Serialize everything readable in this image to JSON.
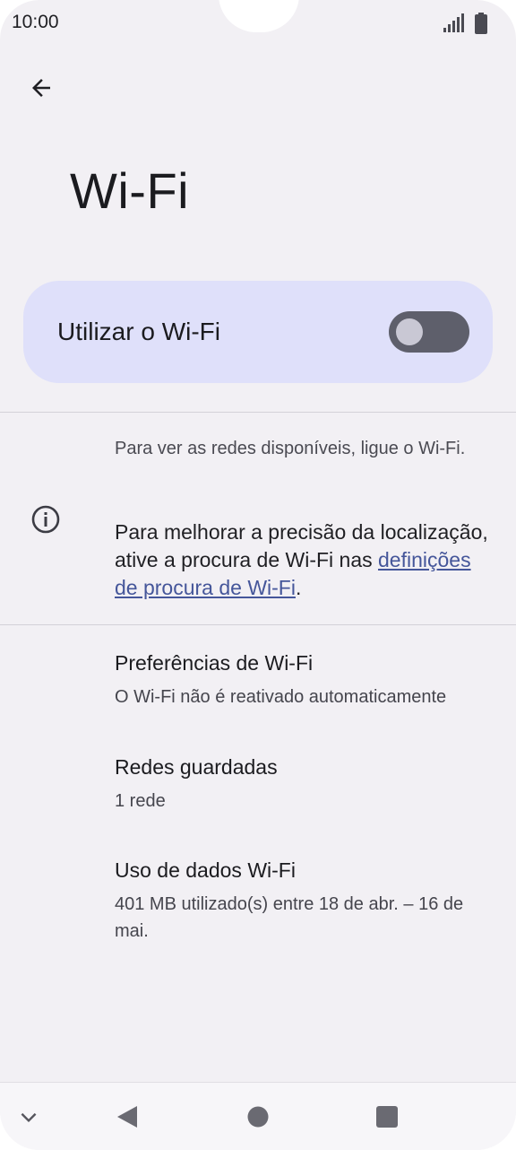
{
  "status_bar": {
    "time": "10:00",
    "icons": [
      "signal-icon",
      "battery-icon"
    ]
  },
  "app_bar": {
    "back_icon": "arrow-back-icon",
    "title": "Wi-Fi"
  },
  "main_switch": {
    "label": "Utilizar o Wi-Fi",
    "checked": false
  },
  "info": {
    "icon": "info-icon",
    "text_1": "Para ver as redes disponíveis, ligue o Wi-Fi.",
    "text_2_prefix": "Para melhorar a precisão da localização, ative a procura de Wi-Fi nas ",
    "text_2_link": "definições de procura de Wi-Fi",
    "text_2_suffix": "."
  },
  "items": [
    {
      "title": "Preferências de Wi-Fi",
      "summary": "O Wi-Fi não é reativado automaticamente"
    },
    {
      "title": "Redes guardadas",
      "summary": "1 rede"
    },
    {
      "title": "Uso de dados Wi-Fi",
      "summary": "401 MB utilizado(s) entre 18 de abr. – 16 de mai."
    }
  ],
  "nav_bar": {
    "buttons": [
      "chevron-down-icon",
      "back-triangle-icon",
      "home-circle-icon",
      "recents-square-icon"
    ]
  },
  "colors": {
    "background": "#f2f0f4",
    "switch_card": "#dfe0fa",
    "toggle_off_track": "#5e5f6b",
    "link": "#45569a"
  }
}
